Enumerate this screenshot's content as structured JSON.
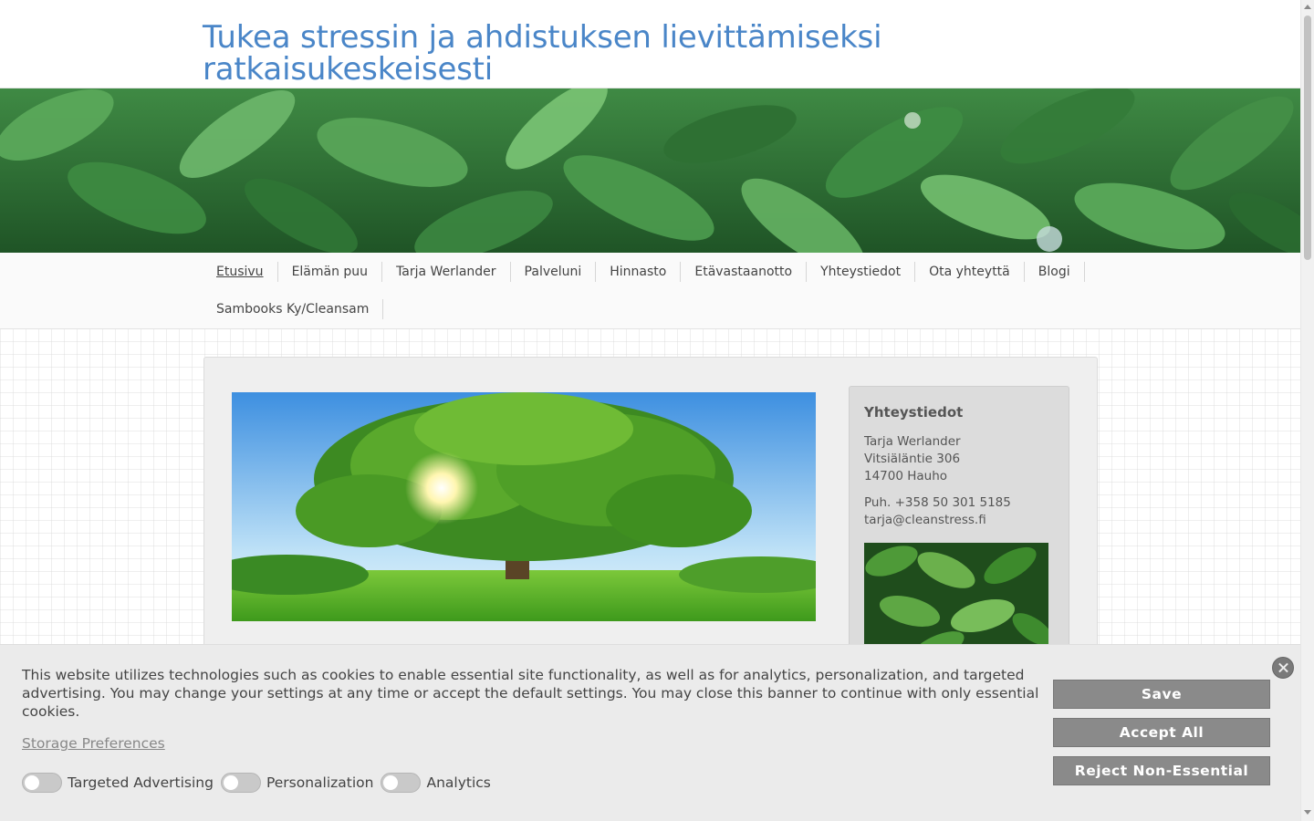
{
  "header": {
    "site_title": "Tukea stressin ja ahdistuksen lievittämiseksi ratkaisukeskeisesti"
  },
  "nav": {
    "row1": [
      "Etusivu",
      "Elämän puu",
      "Tarja Werlander",
      "Palveluni",
      "Hinnasto",
      "Etävastaanotto",
      "Yhteystiedot",
      "Ota yhteyttä",
      "Blogi"
    ],
    "row2": [
      "Sambooks Ky/Cleansam"
    ],
    "active": "Etusivu"
  },
  "sidebar": {
    "title": "Yhteystiedot",
    "name": "Tarja Werlander",
    "street": "Vitsiäläntie 306",
    "city": "14700 Hauho",
    "phone": "Puh. +358 50 301 5185",
    "email": "tarja@cleanstress.fi"
  },
  "cookie": {
    "text": "This website utilizes technologies such as cookies to enable essential site functionality, as well as for analytics, personalization, and targeted advertising. You may change your settings at any time or accept the default settings. You may close this banner to continue with only essential cookies.",
    "storage_link": "Storage Preferences",
    "toggles": [
      "Targeted Advertising",
      "Personalization",
      "Analytics"
    ],
    "save_label": "Save",
    "accept_label": "Accept All",
    "reject_label": "Reject Non-Essential"
  },
  "colors": {
    "title": "#4a86c8",
    "button": "#8a8a8a"
  }
}
